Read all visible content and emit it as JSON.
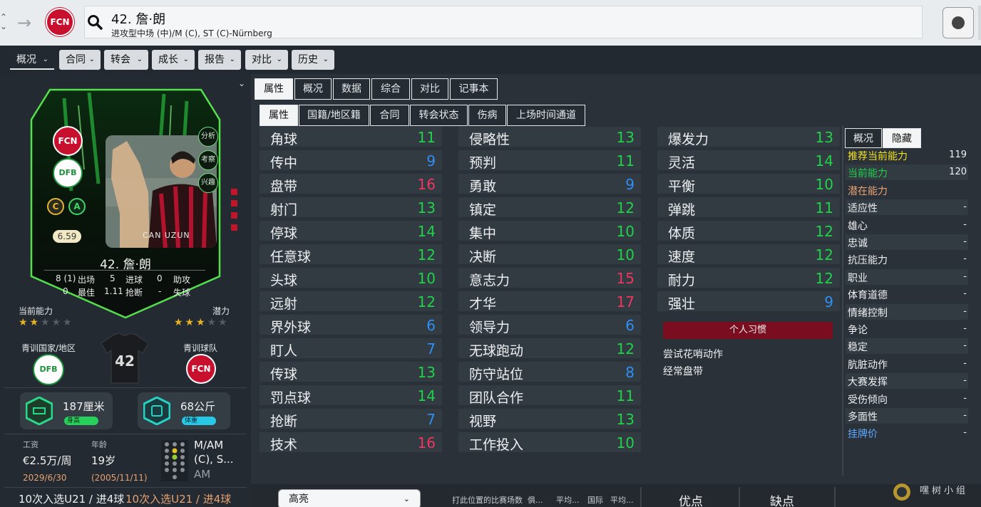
{
  "header": {
    "player_title": "42. 詹·朗",
    "player_subtitle": "进攻型中场 (中)/M (C), ST (C)-Nürnberg",
    "club_badge_text": "FCN"
  },
  "menu_tabs": [
    {
      "label": "概况"
    },
    {
      "label": "合同"
    },
    {
      "label": "转会"
    },
    {
      "label": "成长"
    },
    {
      "label": "报告"
    },
    {
      "label": "对比"
    },
    {
      "label": "历史"
    }
  ],
  "card": {
    "side_pills": [
      "分析",
      "考察",
      "兴趣"
    ],
    "rating": "6.59",
    "name": "42. 詹·朗",
    "stats": {
      "apps": "8 (1)",
      "apps_label": "出场",
      "goals": "5",
      "goals_label": "进球",
      "assists": "0",
      "assists_label": "助攻",
      "best": "0",
      "best_label": "最佳",
      "tackles": "1.11",
      "tackles_label": "抢断",
      "conceded": "-",
      "conceded_label": "失球"
    },
    "photo_caption": "CAN UZUN"
  },
  "ability": {
    "current_label": "当前能力",
    "potential_label": "潜力",
    "current_stars": 2,
    "potential_stars": 3
  },
  "youth": {
    "nation_label": "青训国家/地区",
    "club_label": "青训球队",
    "club_badge_text": "FCN",
    "shirt_number": "42"
  },
  "physical": {
    "height": "187厘米",
    "height_tag": "身高",
    "weight": "68公斤",
    "weight_tag": "体重"
  },
  "contract": {
    "wage_label": "工资",
    "wage": "€2.5万/周",
    "wage_date": "2029/6/30",
    "age_label": "年龄",
    "age": "19岁",
    "birth_date": "(2005/11/11)",
    "position_lines": [
      "M/AM",
      "(C), S...",
      "AM"
    ]
  },
  "bottom_left": {
    "note_a": "10次入选U21 / 进4球",
    "note_b": "10次入选U21 / 进4球"
  },
  "tabs_primary": [
    {
      "label": "属性"
    },
    {
      "label": "概况"
    },
    {
      "label": "数据"
    },
    {
      "label": "综合"
    },
    {
      "label": "对比"
    },
    {
      "label": "记事本"
    }
  ],
  "tabs_secondary": [
    {
      "label": "属性"
    },
    {
      "label": "国籍/地区籍"
    },
    {
      "label": "合同"
    },
    {
      "label": "转会状态"
    },
    {
      "label": "伤病"
    },
    {
      "label": "上场时间通道"
    }
  ],
  "attributes": {
    "technical": [
      {
        "name": "角球",
        "value": "11",
        "color": "#22d14a"
      },
      {
        "name": "传中",
        "value": "9",
        "color": "#2f8ff2"
      },
      {
        "name": "盘带",
        "value": "16",
        "color": "#f0365f"
      },
      {
        "name": "射门",
        "value": "13",
        "color": "#22d14a"
      },
      {
        "name": "停球",
        "value": "14",
        "color": "#22d14a"
      },
      {
        "name": "任意球",
        "value": "12",
        "color": "#22d14a"
      },
      {
        "name": "头球",
        "value": "10",
        "color": "#22d14a"
      },
      {
        "name": "远射",
        "value": "12",
        "color": "#22d14a"
      },
      {
        "name": "界外球",
        "value": "6",
        "color": "#2f8ff2"
      },
      {
        "name": "盯人",
        "value": "7",
        "color": "#2f8ff2"
      },
      {
        "name": "传球",
        "value": "13",
        "color": "#22d14a"
      },
      {
        "name": "罚点球",
        "value": "14",
        "color": "#22d14a"
      },
      {
        "name": "抢断",
        "value": "7",
        "color": "#2f8ff2"
      },
      {
        "name": "技术",
        "value": "16",
        "color": "#f0365f"
      }
    ],
    "mental": [
      {
        "name": "侵略性",
        "value": "13",
        "color": "#22d14a"
      },
      {
        "name": "预判",
        "value": "11",
        "color": "#22d14a"
      },
      {
        "name": "勇敢",
        "value": "9",
        "color": "#2f8ff2"
      },
      {
        "name": "镇定",
        "value": "12",
        "color": "#22d14a"
      },
      {
        "name": "集中",
        "value": "10",
        "color": "#22d14a"
      },
      {
        "name": "决断",
        "value": "10",
        "color": "#22d14a"
      },
      {
        "name": "意志力",
        "value": "15",
        "color": "#f0365f"
      },
      {
        "name": "才华",
        "value": "17",
        "color": "#f0365f"
      },
      {
        "name": "领导力",
        "value": "6",
        "color": "#2f8ff2"
      },
      {
        "name": "无球跑动",
        "value": "12",
        "color": "#22d14a"
      },
      {
        "name": "防守站位",
        "value": "8",
        "color": "#2f8ff2"
      },
      {
        "name": "团队合作",
        "value": "11",
        "color": "#22d14a"
      },
      {
        "name": "视野",
        "value": "13",
        "color": "#22d14a"
      },
      {
        "name": "工作投入",
        "value": "10",
        "color": "#22d14a"
      }
    ],
    "physical": [
      {
        "name": "爆发力",
        "value": "13",
        "color": "#22d14a"
      },
      {
        "name": "灵活",
        "value": "14",
        "color": "#22d14a"
      },
      {
        "name": "平衡",
        "value": "10",
        "color": "#22d14a"
      },
      {
        "name": "弹跳",
        "value": "11",
        "color": "#22d14a"
      },
      {
        "name": "体质",
        "value": "12",
        "color": "#22d14a"
      },
      {
        "name": "速度",
        "value": "12",
        "color": "#22d14a"
      },
      {
        "name": "耐力",
        "value": "12",
        "color": "#22d14a"
      },
      {
        "name": "强壮",
        "value": "9",
        "color": "#2f8ff2"
      }
    ]
  },
  "habits": {
    "title": "个人习惯",
    "items": [
      "尝试花哨动作",
      "经常盘带"
    ]
  },
  "right_panel": {
    "tab_overview": "概况",
    "tab_hidden": "隐藏",
    "rows": [
      {
        "name": "推荐当前能力",
        "value": "119",
        "color": "#f2e21c"
      },
      {
        "name": "当前能力",
        "value": "120",
        "color": "#22d14a"
      },
      {
        "name": "潜在能力",
        "value": "",
        "color": "#e6a273"
      },
      {
        "name": "适应性",
        "value": "-",
        "color": "#eef0f2"
      },
      {
        "name": "雄心",
        "value": "-",
        "color": "#eef0f2"
      },
      {
        "name": "忠诚",
        "value": "-",
        "color": "#eef0f2"
      },
      {
        "name": "抗压能力",
        "value": "-",
        "color": "#eef0f2"
      },
      {
        "name": "职业",
        "value": "-",
        "color": "#eef0f2"
      },
      {
        "name": "体育道德",
        "value": "-",
        "color": "#eef0f2"
      },
      {
        "name": "情绪控制",
        "value": "-",
        "color": "#eef0f2"
      },
      {
        "name": "争论",
        "value": "-",
        "color": "#eef0f2"
      },
      {
        "name": "稳定",
        "value": "-",
        "color": "#eef0f2"
      },
      {
        "name": "肮脏动作",
        "value": "-",
        "color": "#eef0f2"
      },
      {
        "name": "大赛发挥",
        "value": "-",
        "color": "#eef0f2"
      },
      {
        "name": "受伤倾向",
        "value": "-",
        "color": "#eef0f2"
      },
      {
        "name": "多面性",
        "value": "-",
        "color": "#eef0f2"
      },
      {
        "name": "挂牌价",
        "value": "-",
        "color": "#5aa9ff"
      }
    ]
  },
  "bottom_bar": {
    "highlight_select": "高亮",
    "text1": "打此位置的比赛场数",
    "text2": "俱...",
    "text3": "平均...",
    "text4": "国际",
    "text5": "平均...",
    "strengths": "优点",
    "weaknesses": "缺点",
    "watermark": "嘿树小组"
  }
}
